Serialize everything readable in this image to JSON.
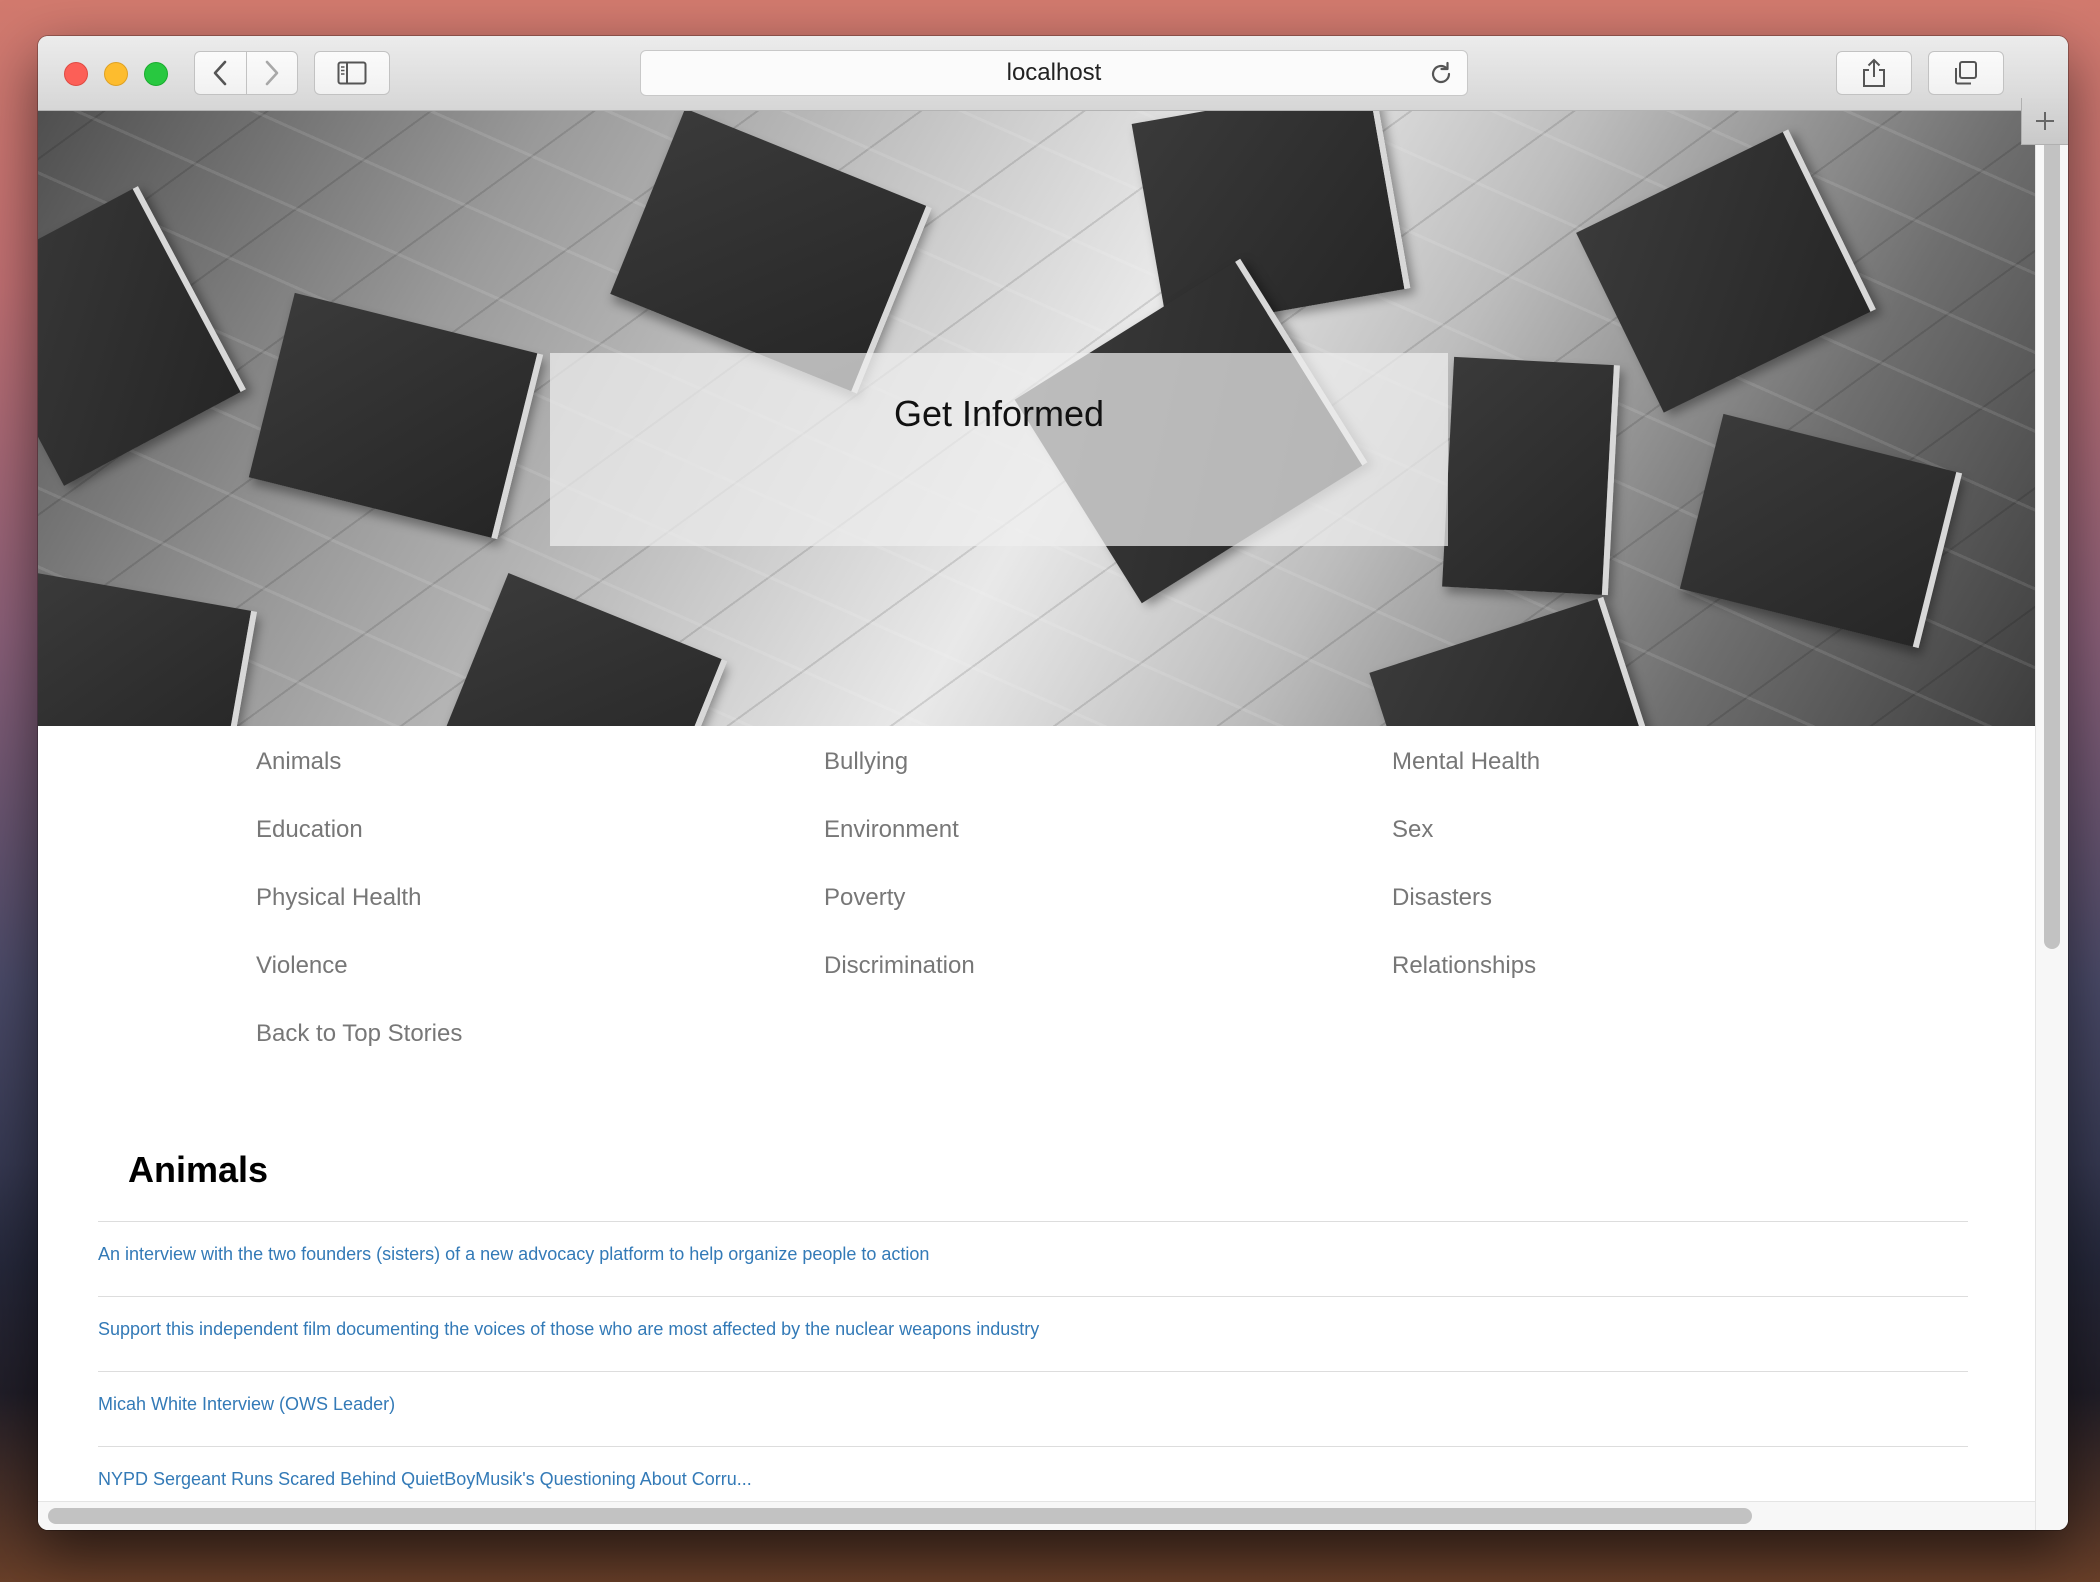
{
  "browser": {
    "url": "localhost",
    "icons": {
      "back": "chevron-left-icon",
      "forward": "chevron-right-icon",
      "sidebar": "sidebar-icon",
      "reload": "reload-icon",
      "share": "share-icon",
      "tabs": "tabs-overview-icon",
      "new_tab": "plus-icon"
    }
  },
  "hero": {
    "title": "Get Informed"
  },
  "categories": {
    "col1": [
      "Animals",
      "Education",
      "Physical Health",
      "Violence",
      "Back to Top Stories"
    ],
    "col2": [
      "Bullying",
      "Environment",
      "Poverty",
      "Discrimination"
    ],
    "col3": [
      "Mental Health",
      "Sex",
      "Disasters",
      "Relationships"
    ]
  },
  "section": {
    "title": "Animals",
    "stories": [
      "An interview with the two founders (sisters) of a new advocacy platform to help organize people to action",
      "Support this independent film documenting the voices of those who are most affected by the nuclear weapons industry",
      "Micah White Interview (OWS Leader)",
      "NYPD Sergeant Runs Scared Behind QuietBoyMusik's Questioning About Corru..."
    ]
  },
  "colors": {
    "category_text": "#777777",
    "link": "#337ab7",
    "divider": "#dddddd"
  }
}
